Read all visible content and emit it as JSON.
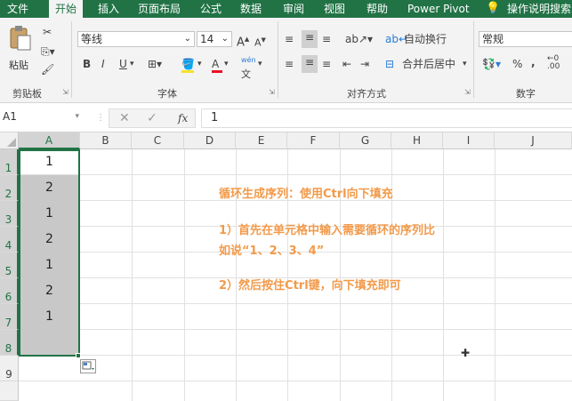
{
  "tabs": [
    "文件",
    "开始",
    "插入",
    "页面布局",
    "公式",
    "数据",
    "审阅",
    "视图",
    "帮助",
    "Power Pivot",
    "操作说明搜索"
  ],
  "clipboard": {
    "paste_label": "粘贴",
    "group_label": "剪贴板"
  },
  "font": {
    "name": "等线",
    "size": "14",
    "group_label": "字体",
    "bold": "B",
    "italic": "I",
    "underline": "U",
    "font_color_glyph": "A",
    "wen_glyph": "wén"
  },
  "alignment": {
    "wrap_label": "自动换行",
    "merge_label": "合并后居中",
    "group_label": "对齐方式"
  },
  "number": {
    "format": "常规",
    "group_label": "数字",
    "percent": "%",
    "comma": ","
  },
  "formula_bar": {
    "name_box": "A1",
    "fx": "fx",
    "value": "1"
  },
  "columns": [
    "A",
    "B",
    "C",
    "D",
    "E",
    "F",
    "G",
    "H",
    "I",
    "J"
  ],
  "rows": [
    "1",
    "2",
    "3",
    "4",
    "5",
    "6",
    "7",
    "8",
    "9"
  ],
  "colA_values": [
    "1",
    "2",
    "1",
    "2",
    "1",
    "2",
    "1"
  ],
  "annotation": {
    "line1": "循环生成序列：使用Ctrl向下填充",
    "line2": "1）首先在单元格中输入需要循环的序列比",
    "line3": "如说“1、2、3、4”",
    "line4": "2）然后按住Ctrl键，向下填充即可"
  },
  "colors": {
    "excel_green": "#217346",
    "annotation": "#f29a4a",
    "selection": "#c8c8c8"
  }
}
